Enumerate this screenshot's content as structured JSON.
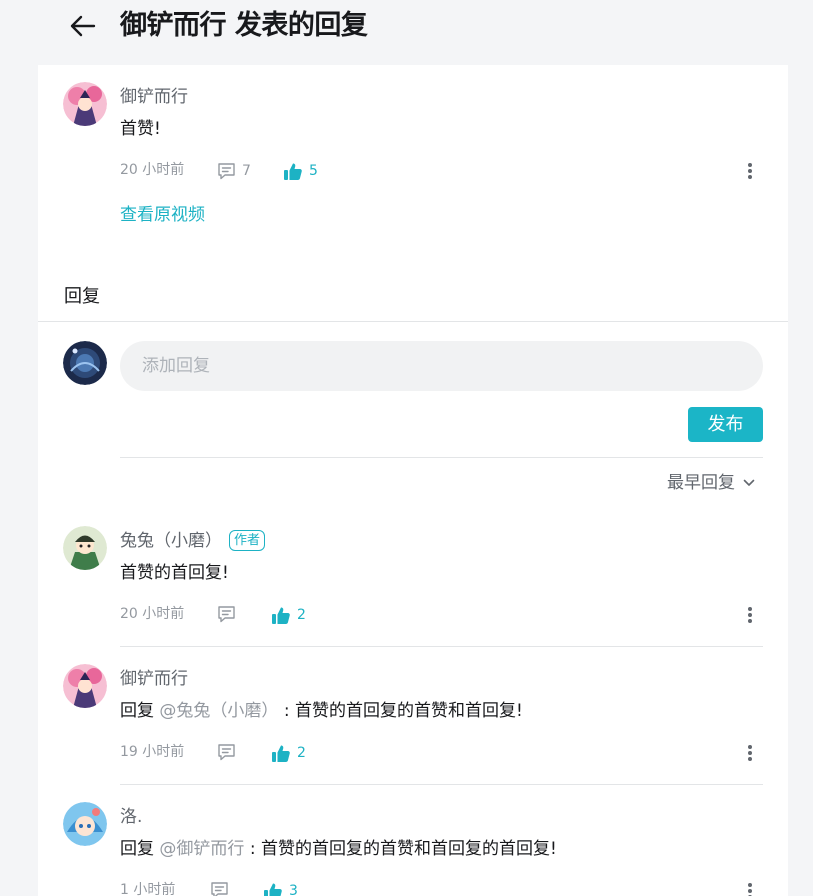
{
  "header": {
    "title": "御铲而行 发表的回复"
  },
  "main_post": {
    "username": "御铲而行",
    "content": "首赞!",
    "time": "20 小时前",
    "reply_count": "7",
    "like_count": "5",
    "view_original": "查看原视频"
  },
  "replies_section": {
    "label": "回复",
    "input_placeholder": "添加回复",
    "publish_label": "发布",
    "sort_label": "最早回复"
  },
  "replies": [
    {
      "username": "兔兔（小磨）",
      "badge": "作者",
      "content": "首赞的首回复!",
      "time": "20 小时前",
      "like_count": "2"
    },
    {
      "username": "御铲而行",
      "reply_prefix": "回复",
      "at_user": "@兔兔（小磨）",
      "content": ": 首赞的首回复的首赞和首回复!",
      "time": "19 小时前",
      "like_count": "2"
    },
    {
      "username": "洛.",
      "reply_prefix": "回复",
      "at_user": "@御铲而行",
      "content": ": 首赞的首回复的首赞和首回复的首回复!",
      "time": "1 小时前",
      "like_count": "3"
    }
  ],
  "colors": {
    "accent": "#1db2c4",
    "publish_button": "#1bb5c7",
    "page_background": "#f4f5f7"
  }
}
